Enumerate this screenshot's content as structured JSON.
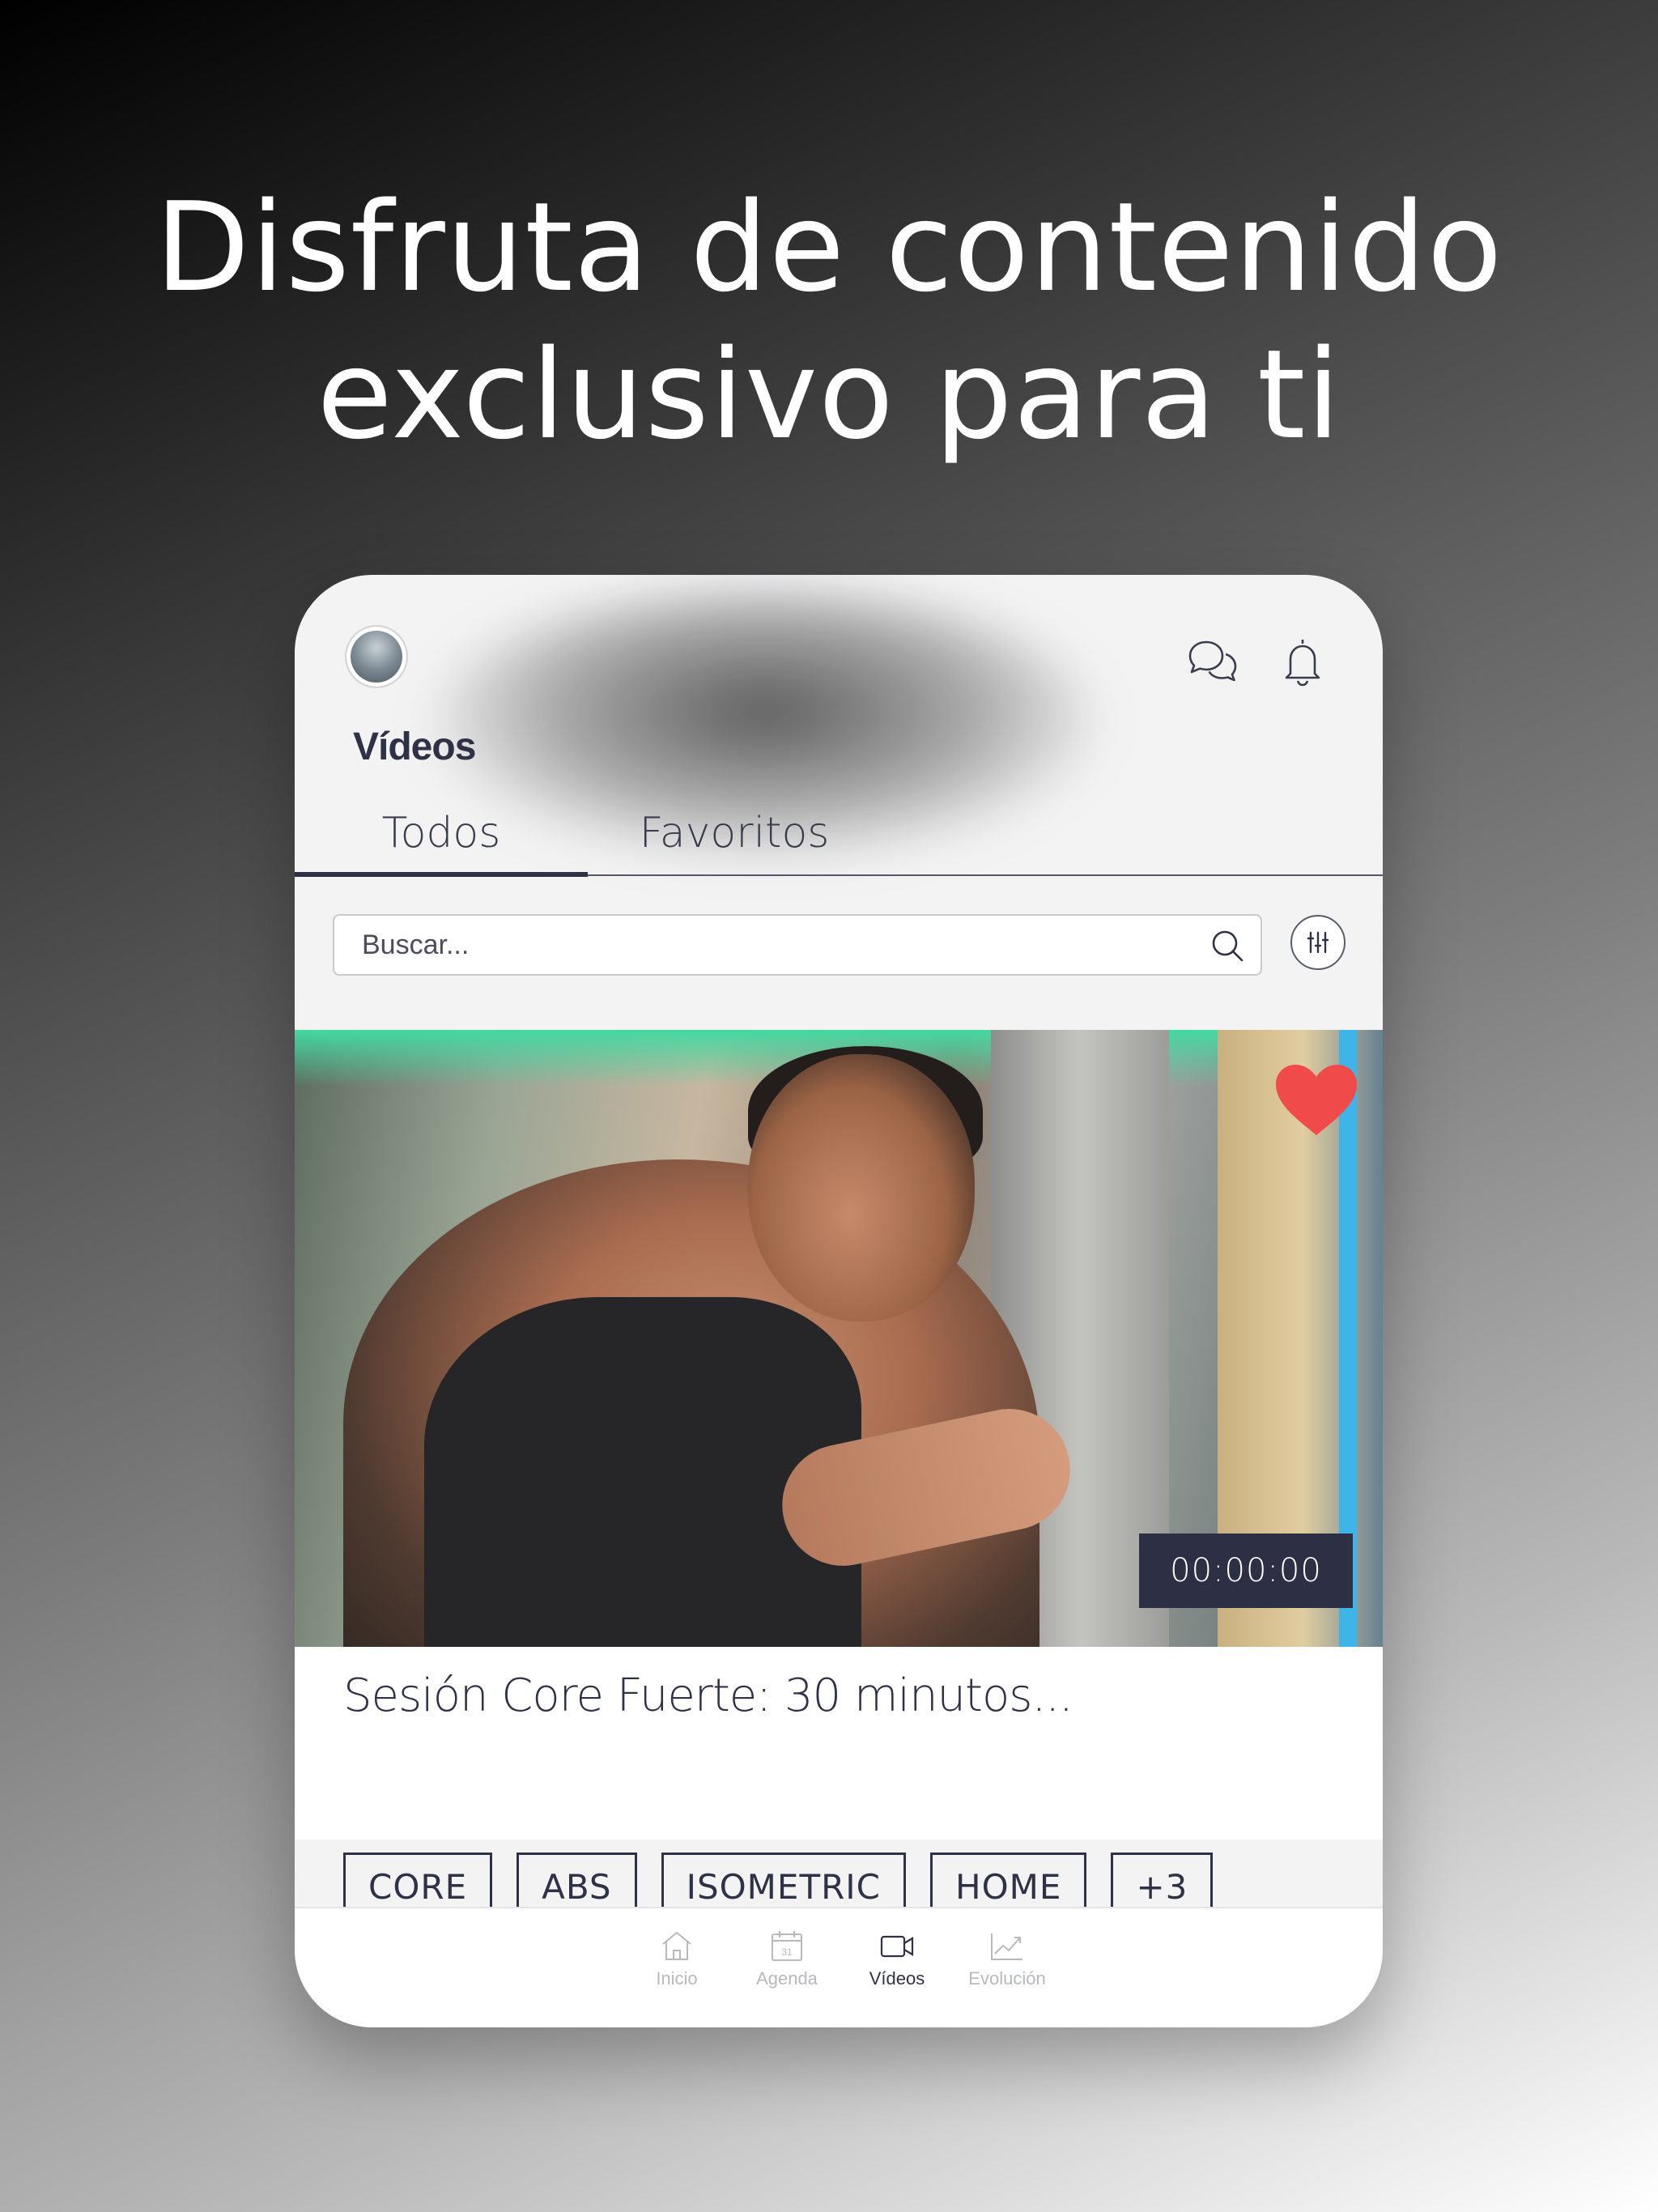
{
  "headline": {
    "line1": "Disfruta de contenido",
    "line2": "exclusivo para ti"
  },
  "topbar": {
    "icons": [
      "avatar",
      "chat-icon",
      "bell-icon"
    ]
  },
  "section_title": "Vídeos",
  "tabs": [
    {
      "label": "Todos",
      "active": true
    },
    {
      "label": "Favoritos",
      "active": false
    }
  ],
  "search": {
    "placeholder": "Buscar...",
    "value": ""
  },
  "video": {
    "favorite": true,
    "duration": "00:00:00",
    "title": "Sesión Core Fuerte: 30 minutos...",
    "tags": [
      "CORE",
      "ABS",
      "ISOMETRIC",
      "HOME",
      "+3"
    ]
  },
  "bottom_nav": {
    "items": [
      {
        "label": "Inicio",
        "icon": "home-icon",
        "active": false
      },
      {
        "label": "Agenda",
        "icon": "calendar-icon",
        "calendar_day": "31",
        "active": false
      },
      {
        "label": "Vídeos",
        "icon": "video-camera-icon",
        "active": true
      },
      {
        "label": "Evolución",
        "icon": "trend-chart-icon",
        "active": false
      }
    ]
  },
  "colors": {
    "brand_dark": "#2f3246",
    "heart": "#f04a4a",
    "inactive_nav": "#b8b9c0"
  }
}
